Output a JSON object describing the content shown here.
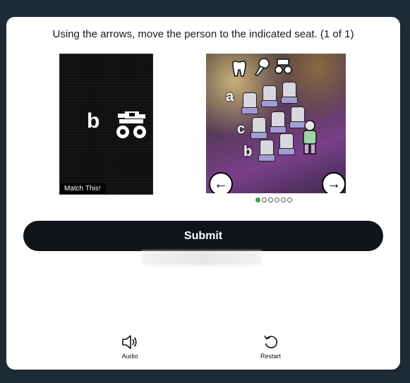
{
  "prompt": "Using the arrows, move the person to the indicated seat. (1 of 1)",
  "target": {
    "letter": "b",
    "icon": "monster-truck-icon",
    "label": "Match This!"
  },
  "scene": {
    "row_labels": [
      "a",
      "c",
      "b"
    ],
    "top_icons": [
      "tooth-icon",
      "ice-cream-icon",
      "monster-truck-icon"
    ],
    "prev_arrow": "←",
    "next_arrow": "→"
  },
  "pagination": {
    "total": 6,
    "current": 1
  },
  "submit_label": "Submit",
  "audio_label": "Audio",
  "restart_label": "Restart"
}
